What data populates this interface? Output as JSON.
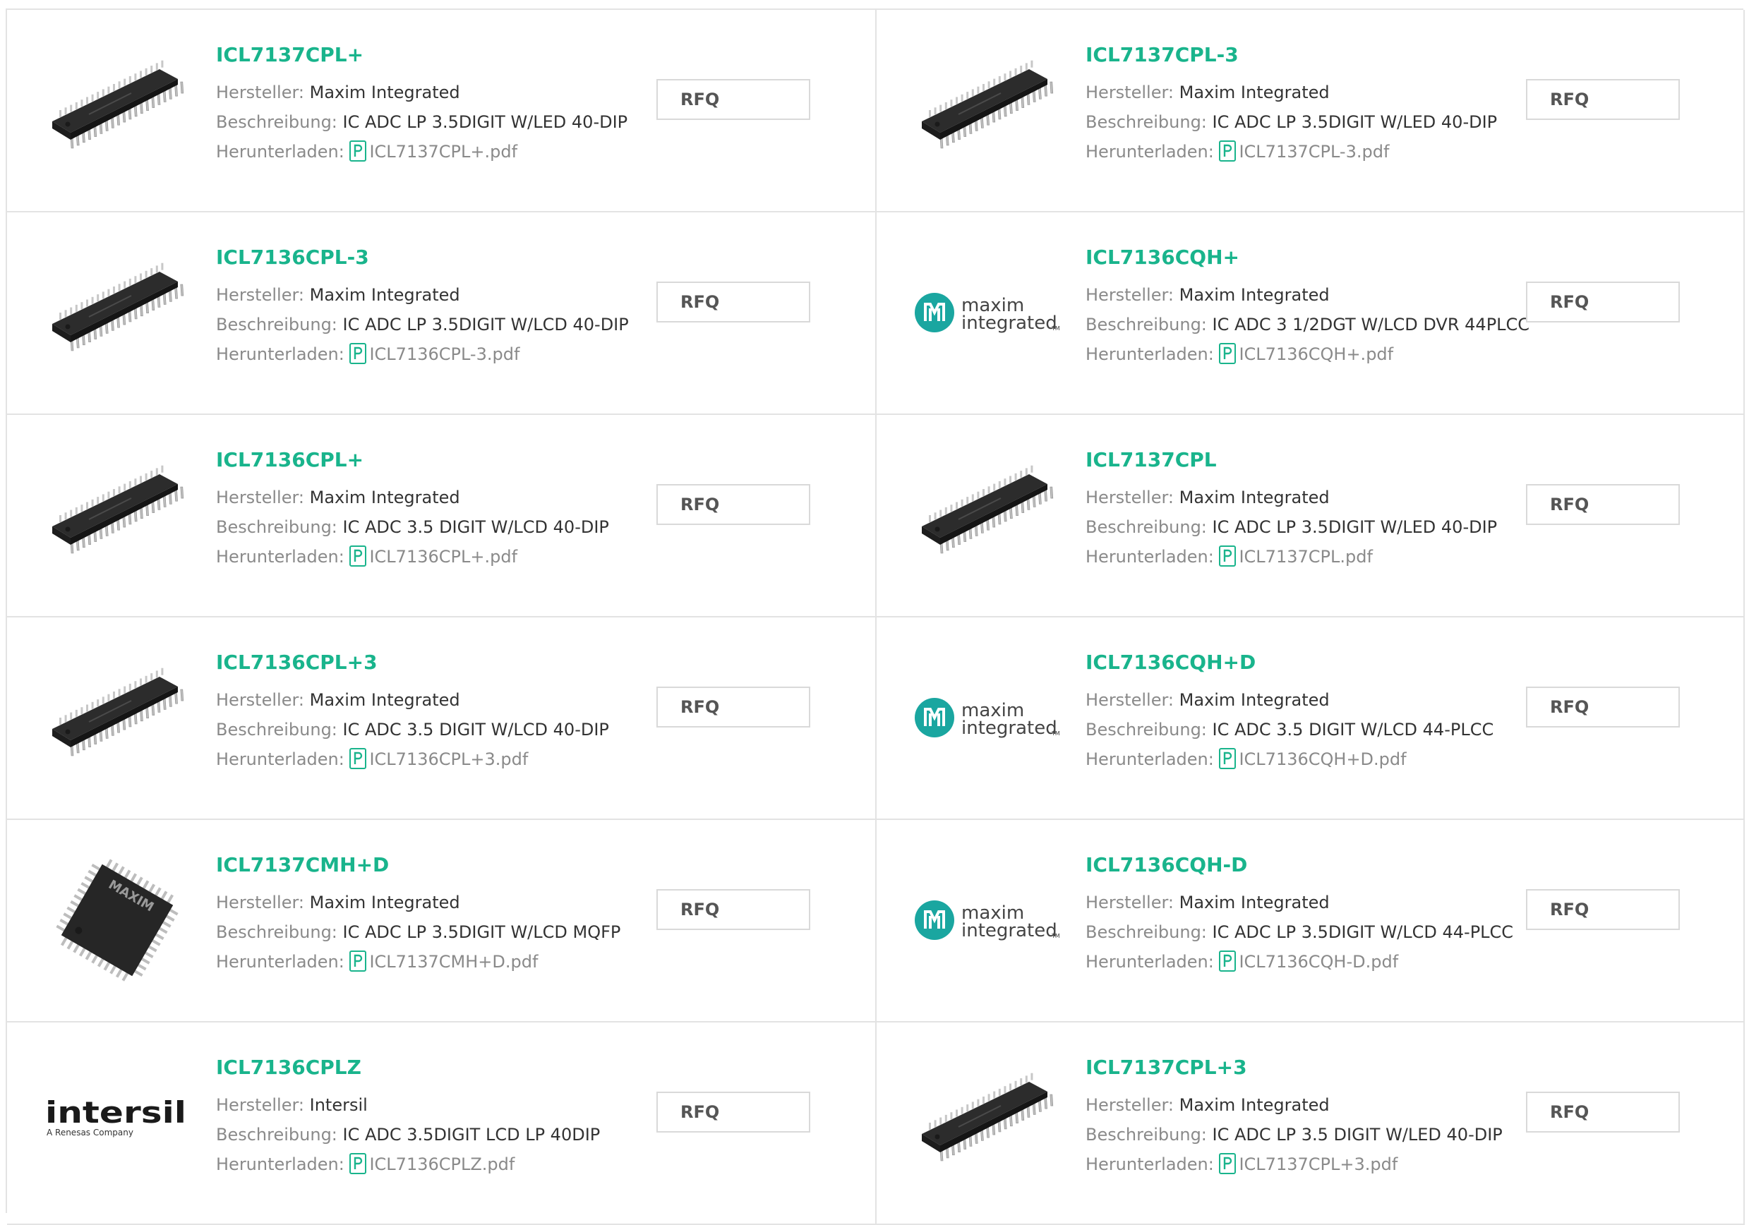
{
  "labels": {
    "manufacturer": "Hersteller:",
    "description": "Beschreibung:",
    "download": "Herunterladen:",
    "rfq": "RFQ"
  },
  "brand_texts": {
    "maxim_line1": "maxim",
    "maxim_line2": "integrated",
    "maxim_tm": "TM",
    "intersil_name": "intersil",
    "intersil_sub": "A Renesas Company",
    "chip_marking": "MAXIM"
  },
  "colors": {
    "accent": "#19b48c",
    "maxim_teal": "#1aa6a0",
    "border": "#e3e3e3"
  },
  "products": [
    {
      "part": "ICL7137CPL+",
      "manufacturer": "Maxim Integrated",
      "description": "IC ADC LP 3.5DIGIT W/LED 40-DIP",
      "pdf": "ICL7137CPL+.pdf",
      "image": "dip40-chip"
    },
    {
      "part": "ICL7137CPL-3",
      "manufacturer": "Maxim Integrated",
      "description": "IC ADC LP 3.5DIGIT W/LED 40-DIP",
      "pdf": "ICL7137CPL-3.pdf",
      "image": "dip40-chip"
    },
    {
      "part": "ICL7136CPL-3",
      "manufacturer": "Maxim Integrated",
      "description": "IC ADC LP 3.5DIGIT W/LCD 40-DIP",
      "pdf": "ICL7136CPL-3.pdf",
      "image": "dip40-chip"
    },
    {
      "part": "ICL7136CQH+",
      "manufacturer": "Maxim Integrated",
      "description": "IC ADC 3 1/2DGT W/LCD DVR 44PLCC",
      "pdf": "ICL7136CQH+.pdf",
      "image": "maxim-logo"
    },
    {
      "part": "ICL7136CPL+",
      "manufacturer": "Maxim Integrated",
      "description": "IC ADC 3.5 DIGIT W/LCD 40-DIP",
      "pdf": "ICL7136CPL+.pdf",
      "image": "dip40-chip"
    },
    {
      "part": "ICL7137CPL",
      "manufacturer": "Maxim Integrated",
      "description": "IC ADC LP 3.5DIGIT W/LED 40-DIP",
      "pdf": "ICL7137CPL.pdf",
      "image": "dip40-chip"
    },
    {
      "part": "ICL7136CPL+3",
      "manufacturer": "Maxim Integrated",
      "description": "IC ADC 3.5 DIGIT W/LCD 40-DIP",
      "pdf": "ICL7136CPL+3.pdf",
      "image": "dip40-chip"
    },
    {
      "part": "ICL7136CQH+D",
      "manufacturer": "Maxim Integrated",
      "description": "IC ADC 3.5 DIGIT W/LCD 44-PLCC",
      "pdf": "ICL7136CQH+D.pdf",
      "image": "maxim-logo"
    },
    {
      "part": "ICL7137CMH+D",
      "manufacturer": "Maxim Integrated",
      "description": "IC ADC LP 3.5DIGIT W/LCD MQFP",
      "pdf": "ICL7137CMH+D.pdf",
      "image": "mqfp-chip"
    },
    {
      "part": "ICL7136CQH-D",
      "manufacturer": "Maxim Integrated",
      "description": "IC ADC LP 3.5DIGIT W/LCD 44-PLCC",
      "pdf": "ICL7136CQH-D.pdf",
      "image": "maxim-logo"
    },
    {
      "part": "ICL7136CPLZ",
      "manufacturer": "Intersil",
      "description": "IC ADC 3.5DIGIT LCD LP 40DIP",
      "pdf": "ICL7136CPLZ.pdf",
      "image": "intersil-logo"
    },
    {
      "part": "ICL7137CPL+3",
      "manufacturer": "Maxim Integrated",
      "description": "IC ADC LP 3.5 DIGIT W/LED 40-DIP",
      "pdf": "ICL7137CPL+3.pdf",
      "image": "dip40-chip"
    }
  ]
}
